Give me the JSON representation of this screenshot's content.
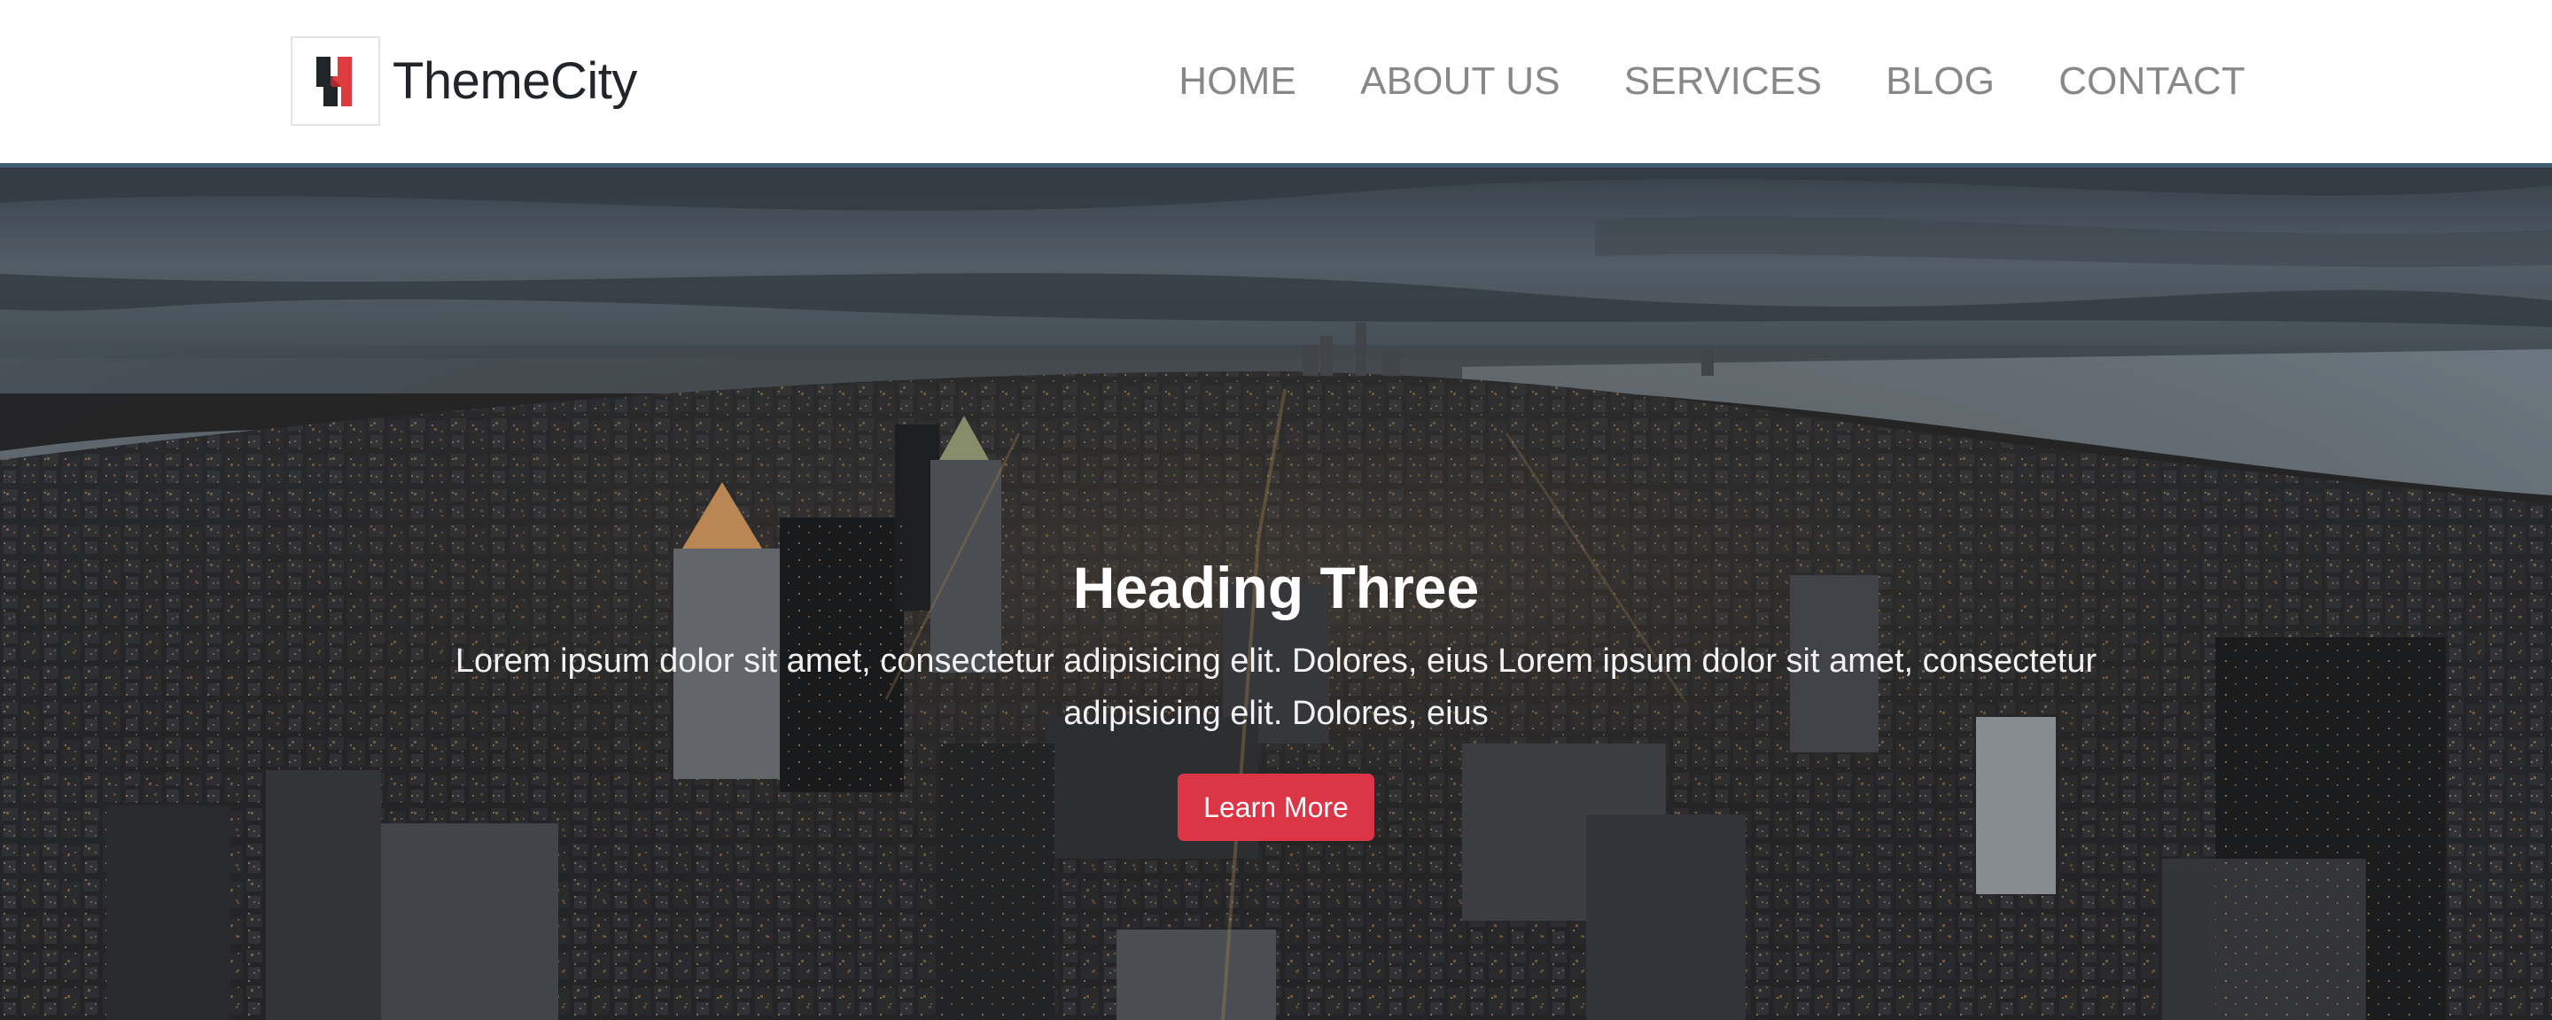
{
  "brand": {
    "name": "ThemeCity",
    "logo_icon": "h-logo-icon",
    "logo_colors": [
      "#212529",
      "#dc3545"
    ]
  },
  "nav": {
    "items": [
      {
        "label": "HOME"
      },
      {
        "label": "ABOUT US"
      },
      {
        "label": "SERVICES"
      },
      {
        "label": "BLOG"
      },
      {
        "label": "CONTACT"
      }
    ]
  },
  "hero": {
    "heading": "Heading Three",
    "text": "Lorem ipsum dolor sit amet, consectetur adipisicing elit. Dolores, eius Lorem ipsum dolor sit amet, consectetur adipisicing elit. Dolores, eius",
    "button_label": "Learn More",
    "background": "city-skyline-night-image"
  },
  "colors": {
    "accent": "#dc3545",
    "nav_text": "#888888",
    "brand_text": "#212529"
  }
}
